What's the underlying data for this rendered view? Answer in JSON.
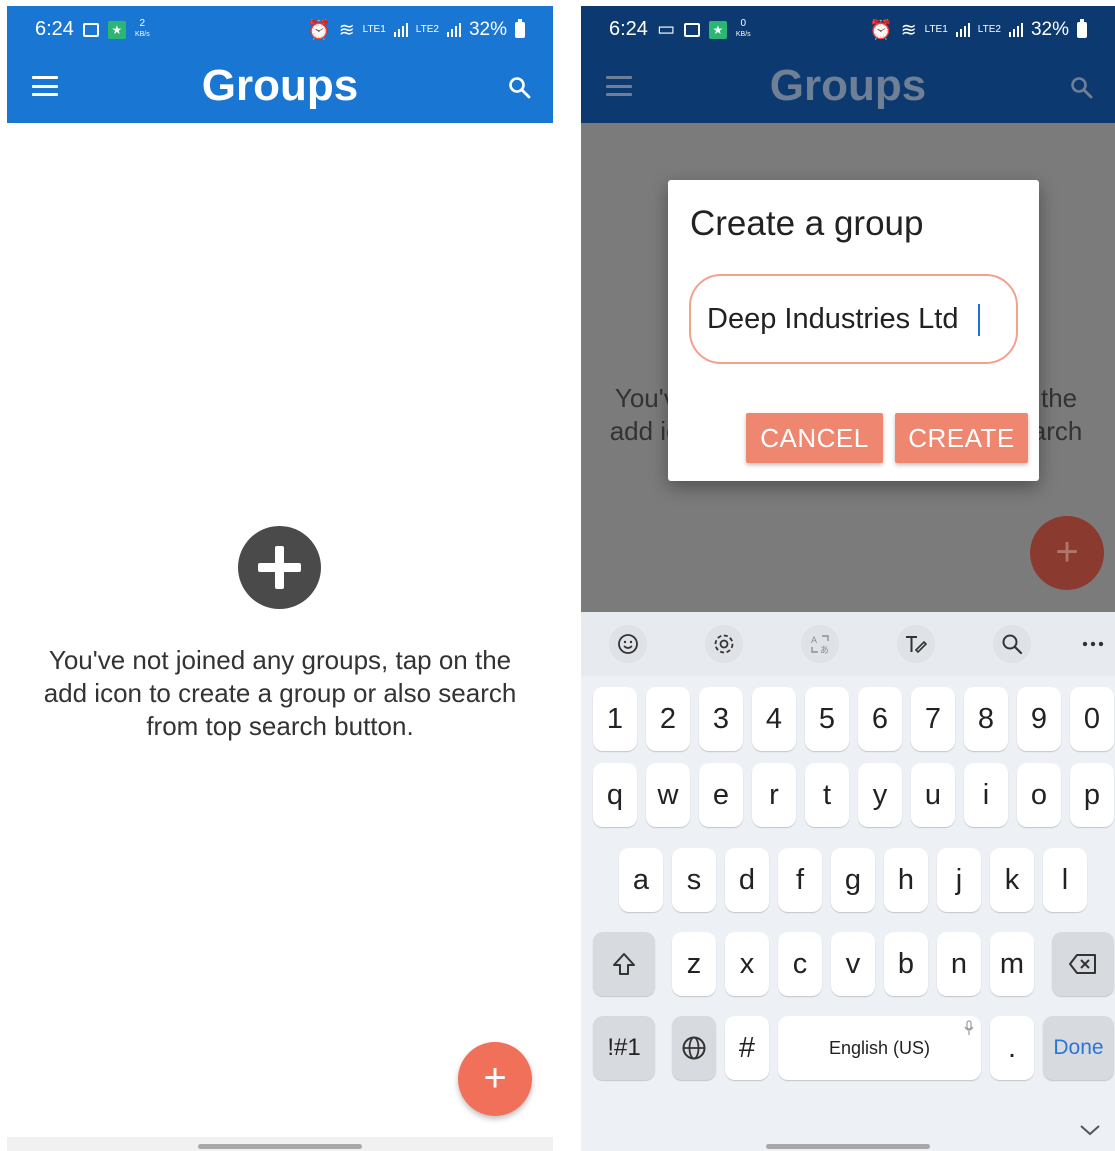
{
  "status": {
    "time": "6:24",
    "speed_left": "2",
    "speed_right": "0",
    "speed_unit": "KB/s",
    "lte1": "LTE1",
    "lte2": "LTE2",
    "battery": "32%"
  },
  "appbar": {
    "title": "Groups"
  },
  "empty_state": {
    "message": "You've not joined any groups, tap on the add icon to create a group or also search from top search button."
  },
  "fab": {
    "symbol": "+"
  },
  "dialog": {
    "title": "Create a group",
    "input_value": "Deep Industries Ltd",
    "cancel_label": "CANCEL",
    "create_label": "CREATE"
  },
  "keyboard": {
    "number_row": [
      "1",
      "2",
      "3",
      "4",
      "5",
      "6",
      "7",
      "8",
      "9",
      "0"
    ],
    "row1": [
      "q",
      "w",
      "e",
      "r",
      "t",
      "y",
      "u",
      "i",
      "o",
      "p"
    ],
    "row2": [
      "a",
      "s",
      "d",
      "f",
      "g",
      "h",
      "j",
      "k",
      "l"
    ],
    "row3": [
      "z",
      "x",
      "c",
      "v",
      "b",
      "n",
      "m"
    ],
    "symbols_label": "!#1",
    "hash_label": "#",
    "space_label": "English (US)",
    "period_label": ".",
    "done_label": "Done",
    "toolbar_icons": [
      "emoji-icon",
      "settings-icon",
      "translate-icon",
      "handwriting-icon",
      "search-icon",
      "more-icon"
    ]
  },
  "colors": {
    "primary": "#1976d2",
    "primary_dimmed": "#0b3970",
    "accent": "#f0705a",
    "dialog_button": "#ef8670",
    "input_border": "#f3a08c"
  }
}
